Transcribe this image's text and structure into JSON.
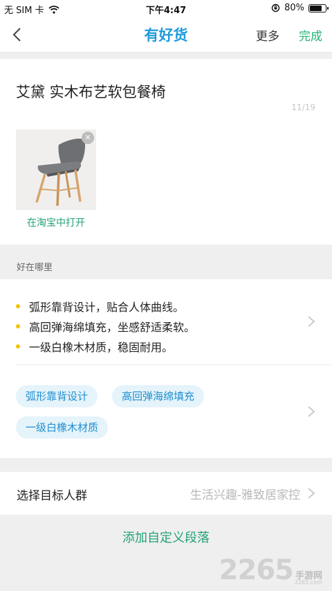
{
  "status_bar": {
    "carrier": "无 SIM 卡",
    "time": "下午4:47",
    "battery_text": "80%",
    "battery_level": 0.8
  },
  "nav": {
    "title": "有好货",
    "more_label": "更多",
    "done_label": "完成"
  },
  "product": {
    "title": "艾黛 实木布艺软包餐椅",
    "char_count": "11/19",
    "open_link": "在淘宝中打开"
  },
  "highlights": {
    "section_label": "好在哪里",
    "points": [
      "弧形靠背设计，贴合人体曲线。",
      "高回弹海绵填充，坐感舒适柔软。",
      "一级白橡木材质，稳固耐用。"
    ],
    "tags": [
      "弧形靠背设计",
      "高回弹海绵填充",
      "一级白橡木材质"
    ]
  },
  "audience": {
    "label": "选择目标人群",
    "value": "生活兴趣-雅致居家控"
  },
  "add_section_label": "添加自定义段落",
  "watermark": {
    "number": "2265",
    "brand": "手游网",
    "url": "2265.com"
  },
  "colors": {
    "accent_green": "#22b573",
    "brand_blue": "#1f9bdb",
    "tag_bg": "#e5f3fb",
    "bullet_yellow": "#f2c200"
  }
}
